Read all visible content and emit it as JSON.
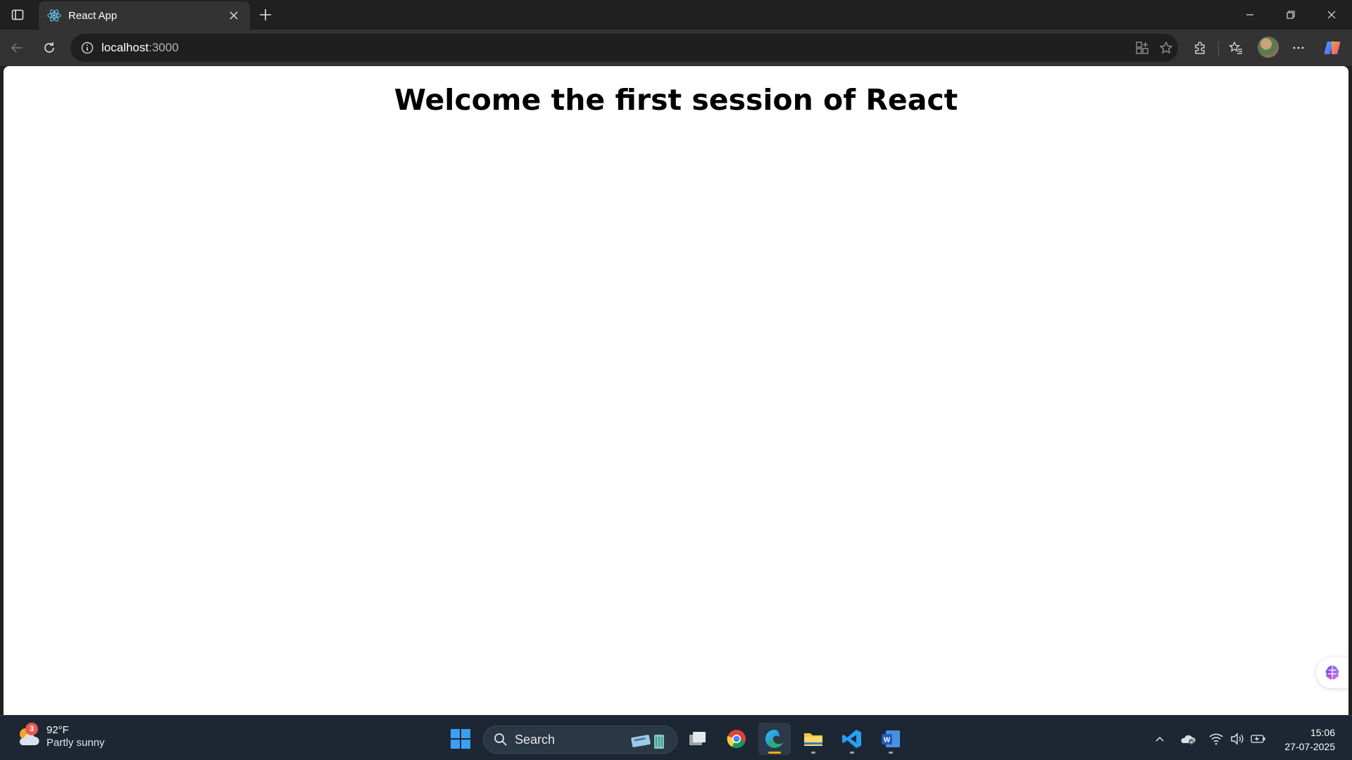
{
  "browser": {
    "tab": {
      "title": "React App"
    },
    "address": {
      "host": "localhost",
      "port": ":3000"
    }
  },
  "page": {
    "heading": "Welcome the first session of React"
  },
  "taskbar": {
    "weather": {
      "badge": "3",
      "temp": "92°F",
      "desc": "Partly sunny"
    },
    "search": {
      "label": "Search"
    },
    "clock": {
      "time": "15:06",
      "date": "27-07-2025"
    }
  }
}
